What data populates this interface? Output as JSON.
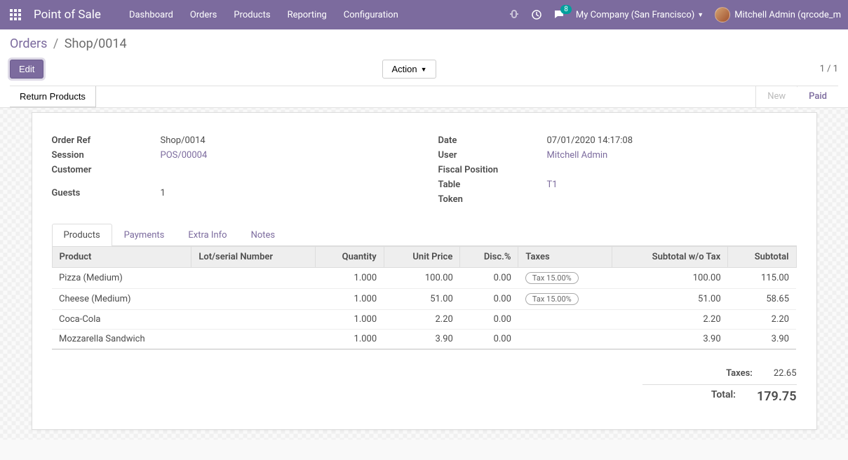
{
  "nav": {
    "title": "Point of Sale",
    "menu": [
      "Dashboard",
      "Orders",
      "Products",
      "Reporting",
      "Configuration"
    ],
    "messages_badge": "8",
    "company": "My Company (San Francisco)",
    "user": "Mitchell Admin (qrcode_m"
  },
  "breadcrumb": {
    "parent": "Orders",
    "current": "Shop/0014"
  },
  "buttons": {
    "edit": "Edit",
    "action": "Action",
    "return": "Return Products"
  },
  "pager": "1 / 1",
  "status": {
    "new": "New",
    "paid": "Paid"
  },
  "fields": {
    "order_ref": {
      "label": "Order Ref",
      "value": "Shop/0014"
    },
    "session": {
      "label": "Session",
      "value": "POS/00004"
    },
    "customer": {
      "label": "Customer",
      "value": ""
    },
    "guests": {
      "label": "Guests",
      "value": "1"
    },
    "date": {
      "label": "Date",
      "value": "07/01/2020 14:17:08"
    },
    "user": {
      "label": "User",
      "value": "Mitchell Admin"
    },
    "fiscal_position": {
      "label": "Fiscal Position",
      "value": ""
    },
    "table": {
      "label": "Table",
      "value": "T1"
    },
    "token": {
      "label": "Token",
      "value": ""
    }
  },
  "tabs": [
    "Products",
    "Payments",
    "Extra Info",
    "Notes"
  ],
  "table": {
    "headers": {
      "product": "Product",
      "lot": "Lot/serial Number",
      "qty": "Quantity",
      "unit_price": "Unit Price",
      "disc": "Disc.%",
      "taxes": "Taxes",
      "sub_no_tax": "Subtotal w/o Tax",
      "subtotal": "Subtotal"
    },
    "rows": [
      {
        "product": "Pizza (Medium)",
        "lot": "",
        "qty": "1.000",
        "unit_price": "100.00",
        "disc": "0.00",
        "taxes": "Tax 15.00%",
        "sub_no_tax": "100.00",
        "subtotal": "115.00"
      },
      {
        "product": "Cheese (Medium)",
        "lot": "",
        "qty": "1.000",
        "unit_price": "51.00",
        "disc": "0.00",
        "taxes": "Tax 15.00%",
        "sub_no_tax": "51.00",
        "subtotal": "58.65"
      },
      {
        "product": "Coca-Cola",
        "lot": "",
        "qty": "1.000",
        "unit_price": "2.20",
        "disc": "0.00",
        "taxes": "",
        "sub_no_tax": "2.20",
        "subtotal": "2.20"
      },
      {
        "product": "Mozzarella Sandwich",
        "lot": "",
        "qty": "1.000",
        "unit_price": "3.90",
        "disc": "0.00",
        "taxes": "",
        "sub_no_tax": "3.90",
        "subtotal": "3.90"
      }
    ]
  },
  "totals": {
    "taxes_label": "Taxes:",
    "taxes_value": "22.65",
    "total_label": "Total:",
    "total_value": "179.75"
  }
}
